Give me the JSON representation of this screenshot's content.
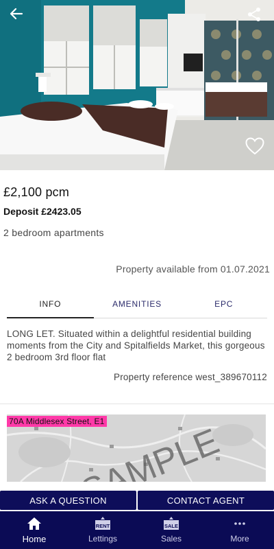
{
  "listing": {
    "price": "£2,100 pcm",
    "deposit": "Deposit £2423.05",
    "property_type": "2 bedroom apartments",
    "availability": "Property available from 01.07.2021",
    "description": "LONG LET. Situated within a delightful residential building moments from the City and Spitalfields Market, this gorgeous 2 bedroom 3rd floor flat",
    "reference": "Property reference west_389670112"
  },
  "tabs": [
    {
      "label": "INFO",
      "active": true
    },
    {
      "label": "AMENITIES",
      "active": false
    },
    {
      "label": "EPC",
      "active": false
    }
  ],
  "map": {
    "address": "70A Middlesex Street, E1",
    "watermark": "SAMPLE"
  },
  "actions": {
    "ask": "ASK A QUESTION",
    "contact": "CONTACT AGENT"
  },
  "nav": {
    "items": [
      {
        "label": "Home",
        "icon": "home-icon",
        "active": true
      },
      {
        "label": "Lettings",
        "icon": "rent-sign-icon",
        "active": false,
        "badge": "RENT"
      },
      {
        "label": "Sales",
        "icon": "sale-sign-icon",
        "active": false,
        "badge": "SALE"
      },
      {
        "label": "More",
        "icon": "more-dots-icon",
        "active": false
      }
    ]
  },
  "icons": {
    "back": "back-arrow-icon",
    "share": "share-icon",
    "favourite": "heart-icon"
  },
  "colors": {
    "brand_navy": "#0b0b55",
    "address_tag": "#ff39a8",
    "accent_wall": "#137a8a"
  }
}
